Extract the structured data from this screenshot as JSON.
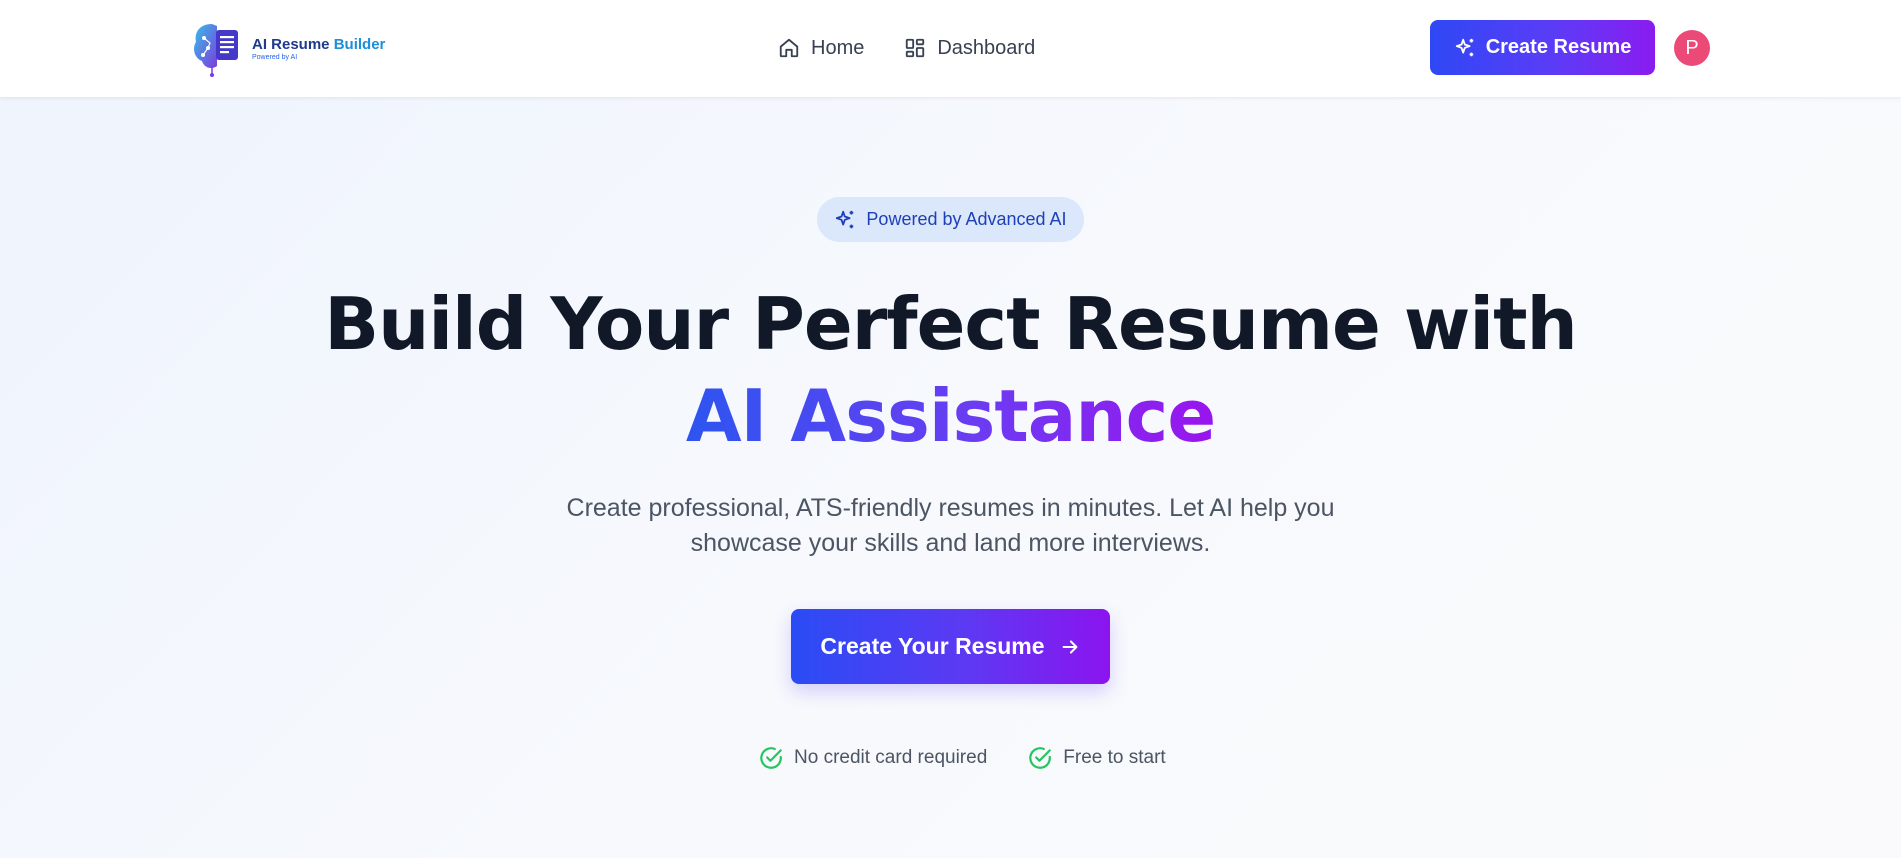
{
  "brand": {
    "name_main": "AI Resume",
    "name_accent": "Builder",
    "tagline": "Powered by AI",
    "logo_icon": "brain-document-logo-icon"
  },
  "nav": {
    "links": [
      {
        "label": "Home",
        "icon": "home-icon"
      },
      {
        "label": "Dashboard",
        "icon": "grid-icon"
      }
    ],
    "cta_label": "Create Resume",
    "cta_icon": "sparkles-icon",
    "avatar_initial": "P"
  },
  "hero": {
    "badge_label": "Powered by Advanced AI",
    "badge_icon": "sparkles-icon",
    "headline_line1": "Build Your Perfect Resume with",
    "headline_line2": "AI Assistance",
    "subtitle_line1": "Create professional, ATS-friendly resumes in minutes. Let AI help you",
    "subtitle_line2": "showcase your skills and land more interviews.",
    "cta_label": "Create Your Resume",
    "cta_icon": "arrow-right-icon",
    "perks": [
      {
        "label": "No credit card required",
        "icon": "check-circle-icon"
      },
      {
        "label": "Free to start",
        "icon": "check-circle-icon"
      }
    ]
  },
  "colors": {
    "accent_start": "#2e48f5",
    "accent_end": "#8a1cf0",
    "avatar": "#ec4a76",
    "check": "#22c55e",
    "badge_bg": "#dbe7fb",
    "heading": "#111827"
  }
}
